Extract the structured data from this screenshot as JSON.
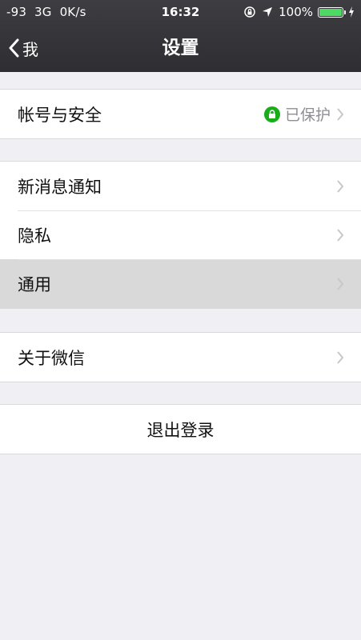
{
  "status_bar": {
    "signal": "-93",
    "network": "3G",
    "speed": "0K/s",
    "time": "16:32",
    "battery": "100%",
    "icons": [
      "rotation-lock-icon",
      "location-arrow-icon",
      "battery-icon",
      "charging-bolt-icon"
    ]
  },
  "nav": {
    "back_label": "我",
    "title": "设置"
  },
  "groups": [
    {
      "items": [
        {
          "label": "帐号与安全",
          "status": "已保护"
        }
      ]
    },
    {
      "items": [
        {
          "label": "新消息通知"
        },
        {
          "label": "隐私"
        },
        {
          "label": "通用",
          "selected": true
        }
      ]
    },
    {
      "items": [
        {
          "label": "关于微信"
        }
      ]
    }
  ],
  "logout_label": "退出登录",
  "colors": {
    "nav_bg": "#2e2e32",
    "page_bg": "#efeff4",
    "accent_green": "#1aad19",
    "battery_green": "#4cd964",
    "selected_row": "#d9d9d9",
    "secondary_text": "#8e8e93"
  }
}
